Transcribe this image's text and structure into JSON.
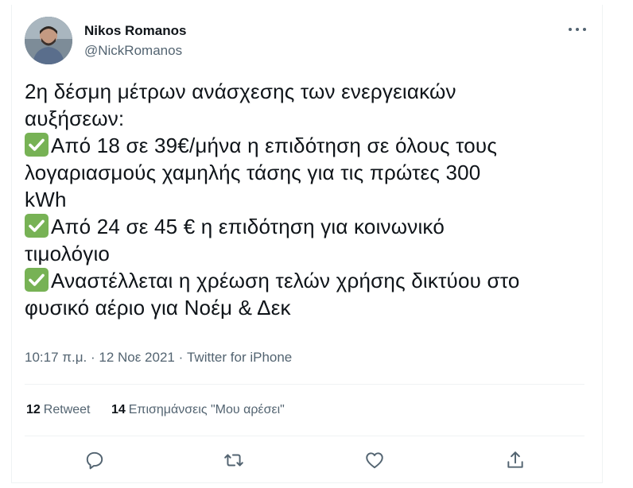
{
  "user": {
    "name": "Nikos Romanos",
    "handle": "@NickRomanos"
  },
  "tweet": {
    "lines": [
      {
        "check": false,
        "text": "2η δέσμη μέτρων ανάσχεσης των ενεργειακών"
      },
      {
        "check": false,
        "text": "αυξήσεων:"
      },
      {
        "check": true,
        "text": "Από 18 σε 39€/μήνα η επιδότηση σε όλους τους"
      },
      {
        "check": false,
        "text": "λογαριασμούς χαμηλής τάσης για τις πρώτες 300"
      },
      {
        "check": false,
        "text": "kWh"
      },
      {
        "check": true,
        "text": "Από 24 σε 45 € η επιδότηση για κοινωνικό"
      },
      {
        "check": false,
        "text": "τιμολόγιο"
      },
      {
        "check": true,
        "text": "Αναστέλλεται η χρέωση τελών χρήσης δικτύου στο"
      },
      {
        "check": false,
        "text": "φυσικό αέριο για Νοέμ & Δεκ"
      }
    ]
  },
  "meta": {
    "time": "10:17 π.μ.",
    "separator": "·",
    "date": "12 Νοε 2021",
    "source": "Twitter for iPhone"
  },
  "stats": {
    "retweets_count": "12",
    "retweets_label": "Retweet",
    "likes_count": "14",
    "likes_label": "Επισημάνσεις \"Μου αρέσει\""
  },
  "colors": {
    "text": "#0f1419",
    "secondary": "#536471",
    "divider": "#eff3f4",
    "check_green": "#77b255"
  },
  "icons": [
    "more-icon",
    "reply-icon",
    "retweet-icon",
    "like-icon",
    "share-icon",
    "check-mark-icon"
  ]
}
